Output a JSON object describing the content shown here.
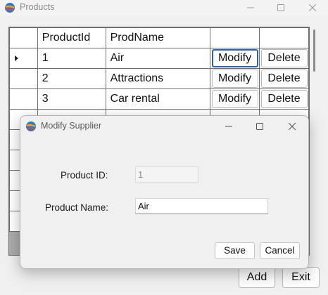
{
  "main_window": {
    "title": "Products",
    "icon": "app-logo-icon",
    "controls": [
      "minimize-icon",
      "maximize-icon",
      "close-icon"
    ]
  },
  "grid": {
    "columns": [
      "",
      "ProductId",
      "ProdName",
      "",
      ""
    ],
    "rows": [
      {
        "id": "1",
        "name": "Air",
        "modify": "Modify",
        "delete": "Delete",
        "current": true
      },
      {
        "id": "2",
        "name": "Attractions",
        "modify": "Modify",
        "delete": "Delete"
      },
      {
        "id": "3",
        "name": "Car rental",
        "modify": "Modify",
        "delete": "Delete"
      }
    ]
  },
  "buttons": {
    "add": "Add",
    "exit": "Exit"
  },
  "dialog": {
    "title": "Modify Supplier",
    "product_id_label": "Product ID:",
    "product_id_value": "1",
    "product_name_label": "Product Name:",
    "product_name_value": "Air",
    "save": "Save",
    "cancel": "Cancel"
  }
}
